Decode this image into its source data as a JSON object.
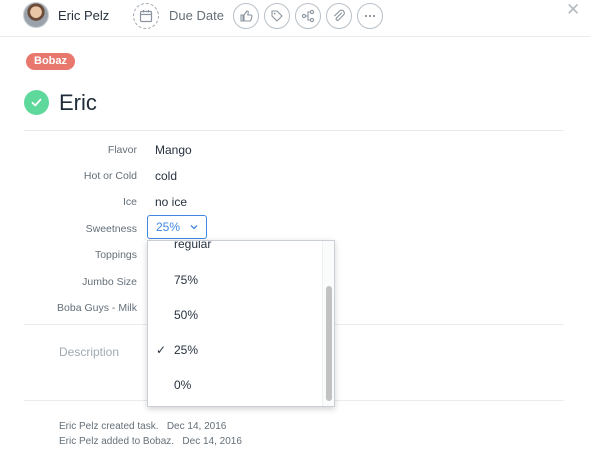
{
  "header": {
    "assignee_name": "Eric Pelz",
    "due_date_label": "Due Date"
  },
  "project_tag": "Bobaz",
  "task": {
    "title": "Eric",
    "completed": true,
    "accent_color": "#5fd89c"
  },
  "fields": [
    {
      "label": "Flavor",
      "value": "Mango"
    },
    {
      "label": "Hot or Cold",
      "value": "cold"
    },
    {
      "label": "Ice",
      "value": "no ice"
    },
    {
      "label": "Sweetness",
      "value": "25%"
    },
    {
      "label": "Toppings",
      "value": ""
    },
    {
      "label": "Jumbo Size",
      "value": ""
    },
    {
      "label": "Boba Guys - Milk",
      "value": ""
    }
  ],
  "dropdown": {
    "options": [
      "regular",
      "75%",
      "50%",
      "25%",
      "0%"
    ],
    "selected": "25%",
    "check_glyph": "✓"
  },
  "description_placeholder": "Description",
  "activity": [
    {
      "text": "Eric Pelz created task.",
      "date": "Dec 14, 2016"
    },
    {
      "text": "Eric Pelz added to Bobaz.",
      "date": "Dec 14, 2016"
    }
  ],
  "icons": [
    "calendar-icon",
    "like-icon",
    "tag-icon",
    "subtask-icon",
    "attachment-icon",
    "more-icon",
    "close-icon",
    "chevron-down-icon",
    "check-icon"
  ],
  "colors": {
    "tag_bg": "#e8786e",
    "select_blue": "#4186e0"
  }
}
